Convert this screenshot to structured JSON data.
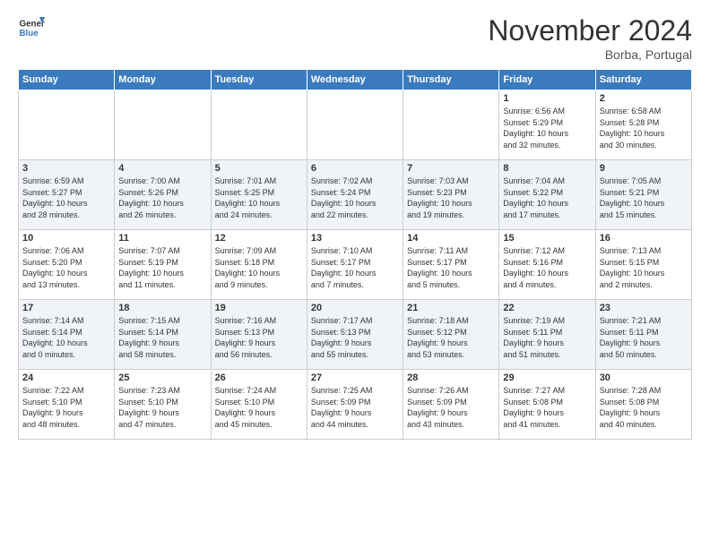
{
  "logo": {
    "line1": "General",
    "line2": "Blue"
  },
  "title": "November 2024",
  "location": "Borba, Portugal",
  "days_header": [
    "Sunday",
    "Monday",
    "Tuesday",
    "Wednesday",
    "Thursday",
    "Friday",
    "Saturday"
  ],
  "weeks": [
    [
      {
        "day": "",
        "info": ""
      },
      {
        "day": "",
        "info": ""
      },
      {
        "day": "",
        "info": ""
      },
      {
        "day": "",
        "info": ""
      },
      {
        "day": "",
        "info": ""
      },
      {
        "day": "1",
        "info": "Sunrise: 6:56 AM\nSunset: 5:29 PM\nDaylight: 10 hours\nand 32 minutes."
      },
      {
        "day": "2",
        "info": "Sunrise: 6:58 AM\nSunset: 5:28 PM\nDaylight: 10 hours\nand 30 minutes."
      }
    ],
    [
      {
        "day": "3",
        "info": "Sunrise: 6:59 AM\nSunset: 5:27 PM\nDaylight: 10 hours\nand 28 minutes."
      },
      {
        "day": "4",
        "info": "Sunrise: 7:00 AM\nSunset: 5:26 PM\nDaylight: 10 hours\nand 26 minutes."
      },
      {
        "day": "5",
        "info": "Sunrise: 7:01 AM\nSunset: 5:25 PM\nDaylight: 10 hours\nand 24 minutes."
      },
      {
        "day": "6",
        "info": "Sunrise: 7:02 AM\nSunset: 5:24 PM\nDaylight: 10 hours\nand 22 minutes."
      },
      {
        "day": "7",
        "info": "Sunrise: 7:03 AM\nSunset: 5:23 PM\nDaylight: 10 hours\nand 19 minutes."
      },
      {
        "day": "8",
        "info": "Sunrise: 7:04 AM\nSunset: 5:22 PM\nDaylight: 10 hours\nand 17 minutes."
      },
      {
        "day": "9",
        "info": "Sunrise: 7:05 AM\nSunset: 5:21 PM\nDaylight: 10 hours\nand 15 minutes."
      }
    ],
    [
      {
        "day": "10",
        "info": "Sunrise: 7:06 AM\nSunset: 5:20 PM\nDaylight: 10 hours\nand 13 minutes."
      },
      {
        "day": "11",
        "info": "Sunrise: 7:07 AM\nSunset: 5:19 PM\nDaylight: 10 hours\nand 11 minutes."
      },
      {
        "day": "12",
        "info": "Sunrise: 7:09 AM\nSunset: 5:18 PM\nDaylight: 10 hours\nand 9 minutes."
      },
      {
        "day": "13",
        "info": "Sunrise: 7:10 AM\nSunset: 5:17 PM\nDaylight: 10 hours\nand 7 minutes."
      },
      {
        "day": "14",
        "info": "Sunrise: 7:11 AM\nSunset: 5:17 PM\nDaylight: 10 hours\nand 5 minutes."
      },
      {
        "day": "15",
        "info": "Sunrise: 7:12 AM\nSunset: 5:16 PM\nDaylight: 10 hours\nand 4 minutes."
      },
      {
        "day": "16",
        "info": "Sunrise: 7:13 AM\nSunset: 5:15 PM\nDaylight: 10 hours\nand 2 minutes."
      }
    ],
    [
      {
        "day": "17",
        "info": "Sunrise: 7:14 AM\nSunset: 5:14 PM\nDaylight: 10 hours\nand 0 minutes."
      },
      {
        "day": "18",
        "info": "Sunrise: 7:15 AM\nSunset: 5:14 PM\nDaylight: 9 hours\nand 58 minutes."
      },
      {
        "day": "19",
        "info": "Sunrise: 7:16 AM\nSunset: 5:13 PM\nDaylight: 9 hours\nand 56 minutes."
      },
      {
        "day": "20",
        "info": "Sunrise: 7:17 AM\nSunset: 5:13 PM\nDaylight: 9 hours\nand 55 minutes."
      },
      {
        "day": "21",
        "info": "Sunrise: 7:18 AM\nSunset: 5:12 PM\nDaylight: 9 hours\nand 53 minutes."
      },
      {
        "day": "22",
        "info": "Sunrise: 7:19 AM\nSunset: 5:11 PM\nDaylight: 9 hours\nand 51 minutes."
      },
      {
        "day": "23",
        "info": "Sunrise: 7:21 AM\nSunset: 5:11 PM\nDaylight: 9 hours\nand 50 minutes."
      }
    ],
    [
      {
        "day": "24",
        "info": "Sunrise: 7:22 AM\nSunset: 5:10 PM\nDaylight: 9 hours\nand 48 minutes."
      },
      {
        "day": "25",
        "info": "Sunrise: 7:23 AM\nSunset: 5:10 PM\nDaylight: 9 hours\nand 47 minutes."
      },
      {
        "day": "26",
        "info": "Sunrise: 7:24 AM\nSunset: 5:10 PM\nDaylight: 9 hours\nand 45 minutes."
      },
      {
        "day": "27",
        "info": "Sunrise: 7:25 AM\nSunset: 5:09 PM\nDaylight: 9 hours\nand 44 minutes."
      },
      {
        "day": "28",
        "info": "Sunrise: 7:26 AM\nSunset: 5:09 PM\nDaylight: 9 hours\nand 43 minutes."
      },
      {
        "day": "29",
        "info": "Sunrise: 7:27 AM\nSunset: 5:08 PM\nDaylight: 9 hours\nand 41 minutes."
      },
      {
        "day": "30",
        "info": "Sunrise: 7:28 AM\nSunset: 5:08 PM\nDaylight: 9 hours\nand 40 minutes."
      }
    ]
  ]
}
